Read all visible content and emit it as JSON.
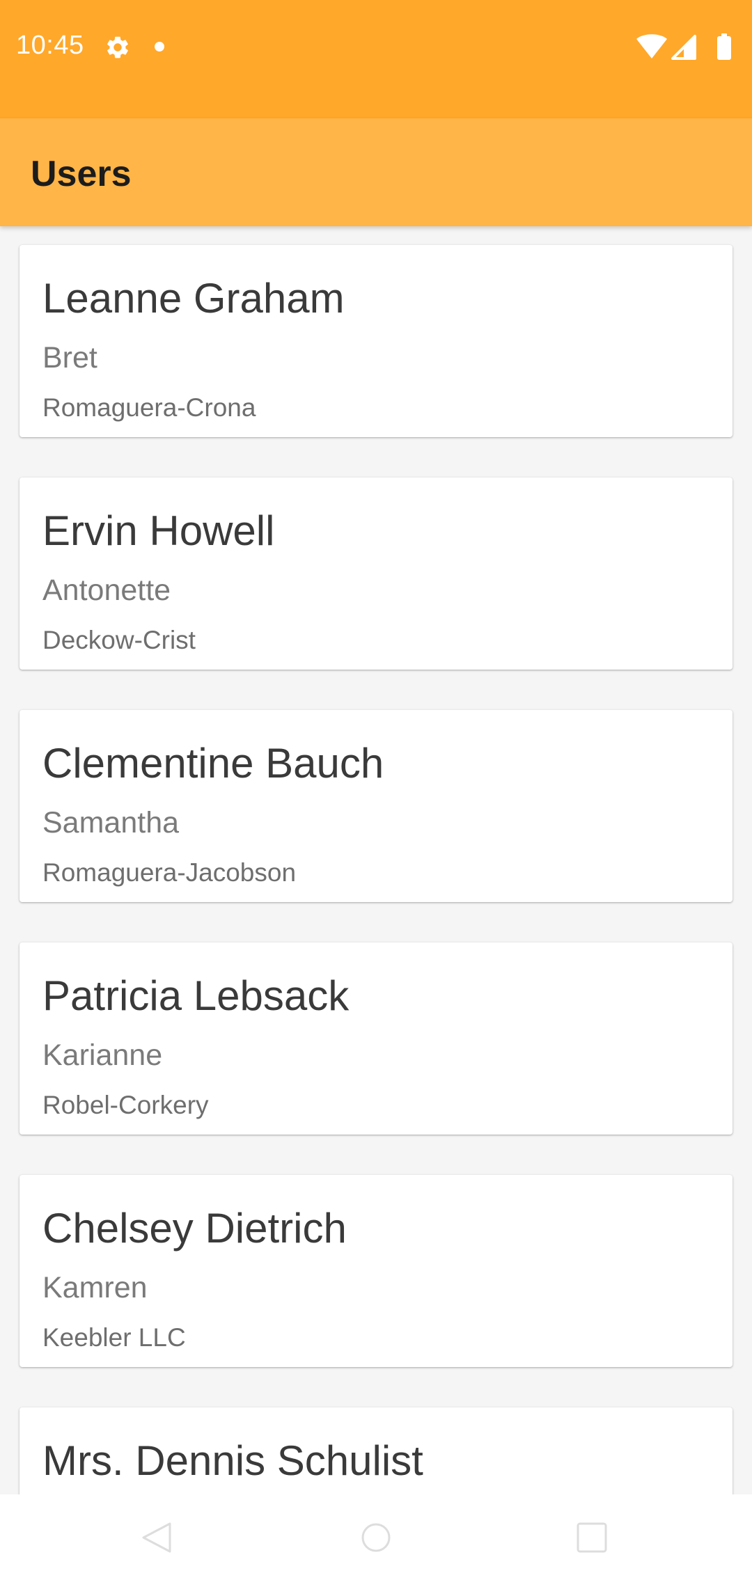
{
  "status_bar": {
    "time": "10:45",
    "left_icons": [
      "gear-icon",
      "notification-dot-icon"
    ],
    "right_icons": [
      "wifi-icon",
      "signal-icon",
      "battery-icon"
    ],
    "background": "#ffa82a"
  },
  "app_bar": {
    "title": "Users",
    "background": "#ffb547"
  },
  "users": [
    {
      "name": "Leanne Graham",
      "username": "Bret",
      "company": "Romaguera-Crona"
    },
    {
      "name": "Ervin Howell",
      "username": "Antonette",
      "company": "Deckow-Crist"
    },
    {
      "name": "Clementine Bauch",
      "username": "Samantha",
      "company": "Romaguera-Jacobson"
    },
    {
      "name": "Patricia Lebsack",
      "username": "Karianne",
      "company": "Robel-Corkery"
    },
    {
      "name": "Chelsey Dietrich",
      "username": "Kamren",
      "company": "Keebler LLC"
    },
    {
      "name": "Mrs. Dennis Schulist",
      "username": "",
      "company": ""
    }
  ],
  "nav_bar": {
    "buttons": [
      "back-icon",
      "home-icon",
      "recents-icon"
    ]
  }
}
